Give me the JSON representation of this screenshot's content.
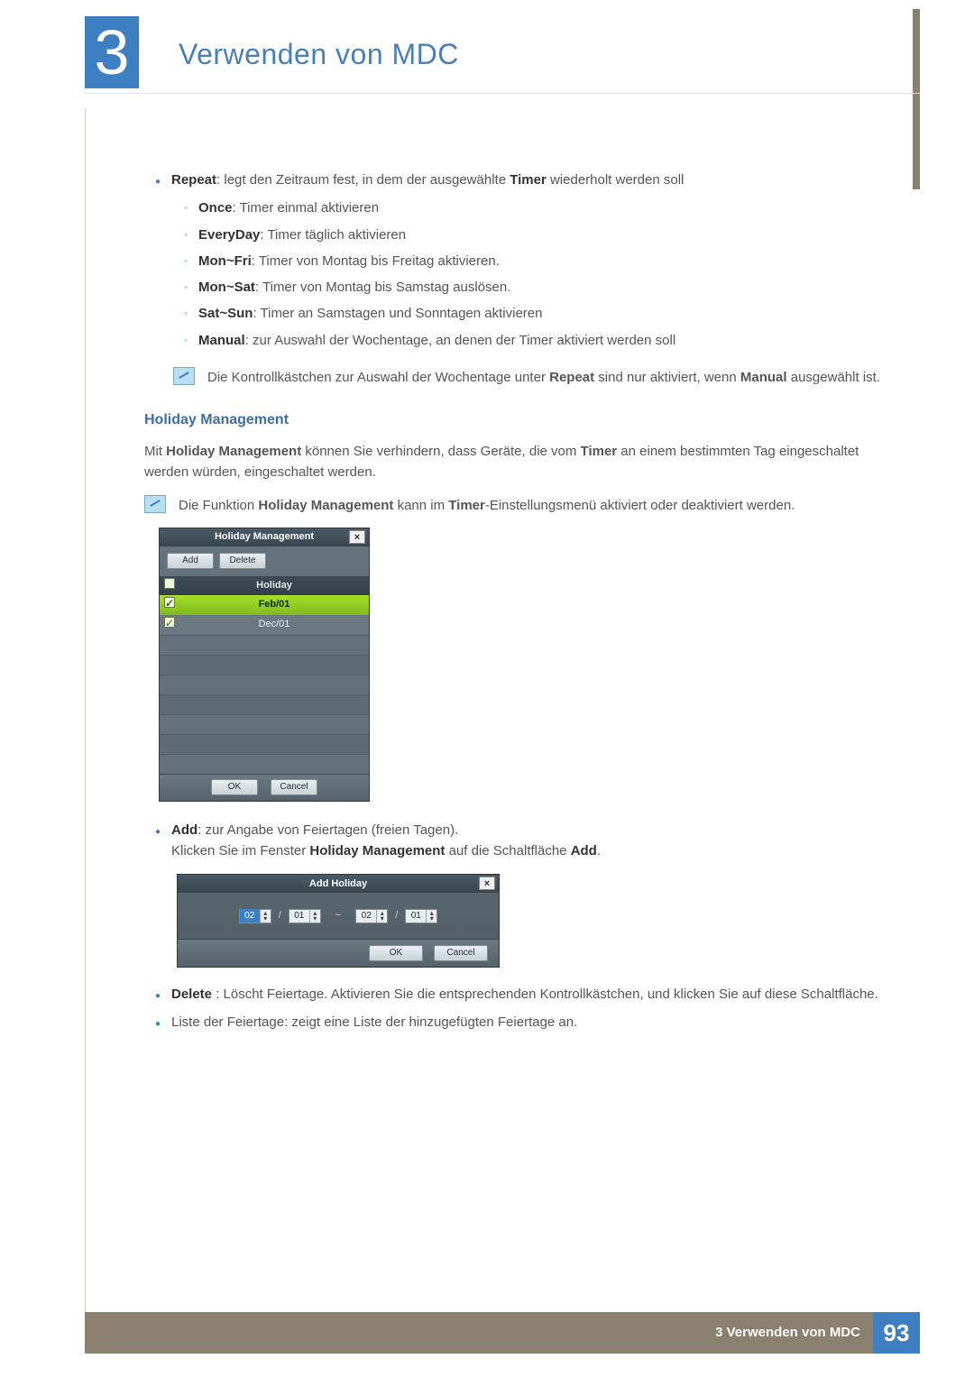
{
  "chapter": {
    "number": "3",
    "title": "Verwenden von MDC"
  },
  "repeat": {
    "label": "Repeat",
    "desc": ": legt den Zeitraum fest, in dem der ausgewählte ",
    "timer": "Timer",
    "desc2": " wiederholt werden soll",
    "items": [
      {
        "name": "Once",
        "desc": ": Timer einmal aktivieren"
      },
      {
        "name": "EveryDay",
        "desc": ": Timer täglich aktivieren"
      },
      {
        "name": "Mon~Fri",
        "desc": ": Timer von Montag bis Freitag aktivieren."
      },
      {
        "name": "Mon~Sat",
        "desc": ": Timer von Montag bis Samstag auslösen."
      },
      {
        "name": "Sat~Sun",
        "desc": ": Timer an Samstagen und Sonntagen aktivieren"
      },
      {
        "name": "Manual",
        "desc": ": zur Auswahl der Wochentage, an denen der Timer aktiviert werden soll"
      }
    ],
    "note_pre": "Die Kontrollkästchen zur Auswahl der Wochentage unter ",
    "note_b1": "Repeat",
    "note_mid": " sind nur aktiviert, wenn ",
    "note_b2": "Manual",
    "note_post": " ausgewählt ist."
  },
  "hm_section": {
    "heading": "Holiday Management",
    "p_pre": "Mit ",
    "p_b1": "Holiday Management",
    "p_mid": " können Sie verhindern, dass Geräte, die vom ",
    "p_b2": "Timer",
    "p_post": " an einem bestimmten Tag eingeschaltet werden würden, eingeschaltet werden.",
    "note_pre": "Die Funktion ",
    "note_b1": "Holiday Management",
    "note_mid": " kann im ",
    "note_b2": "Timer",
    "note_post": "-Einstellungsmenü aktiviert oder deaktiviert werden."
  },
  "hm_dialog": {
    "title": "Holiday Management",
    "add": "Add",
    "delete": "Delete",
    "col_holiday": "Holiday",
    "rows": [
      {
        "checked": true,
        "date": "Feb/01",
        "selected": true
      },
      {
        "checked": true,
        "date": "Dec/01",
        "selected": false
      }
    ],
    "ok": "OK",
    "cancel": "Cancel",
    "close": "×"
  },
  "add_bullet": {
    "b": "Add",
    "desc": ": zur Angabe von Feiertagen (freien Tagen).",
    "line2_pre": "Klicken Sie im Fenster ",
    "line2_b1": "Holiday Management",
    "line2_mid": " auf die Schaltfläche ",
    "line2_b2": "Add",
    "line2_post": "."
  },
  "ah_dialog": {
    "title": "Add Holiday",
    "from_month": "02",
    "from_day": "01",
    "to_month": "02",
    "to_day": "01",
    "tilde": "~",
    "slash": "/",
    "ok": "OK",
    "cancel": "Cancel",
    "close": "×"
  },
  "delete_bullet": {
    "b": "Delete",
    "desc": " : Löscht Feiertage. Aktivieren Sie die entsprechenden Kontrollkästchen, und klicken Sie auf diese Schaltfläche."
  },
  "list_bullet": "Liste der Feiertage: zeigt eine Liste der hinzugefügten Feiertage an.",
  "footer": {
    "label": "3 Verwenden von MDC",
    "page": "93"
  }
}
